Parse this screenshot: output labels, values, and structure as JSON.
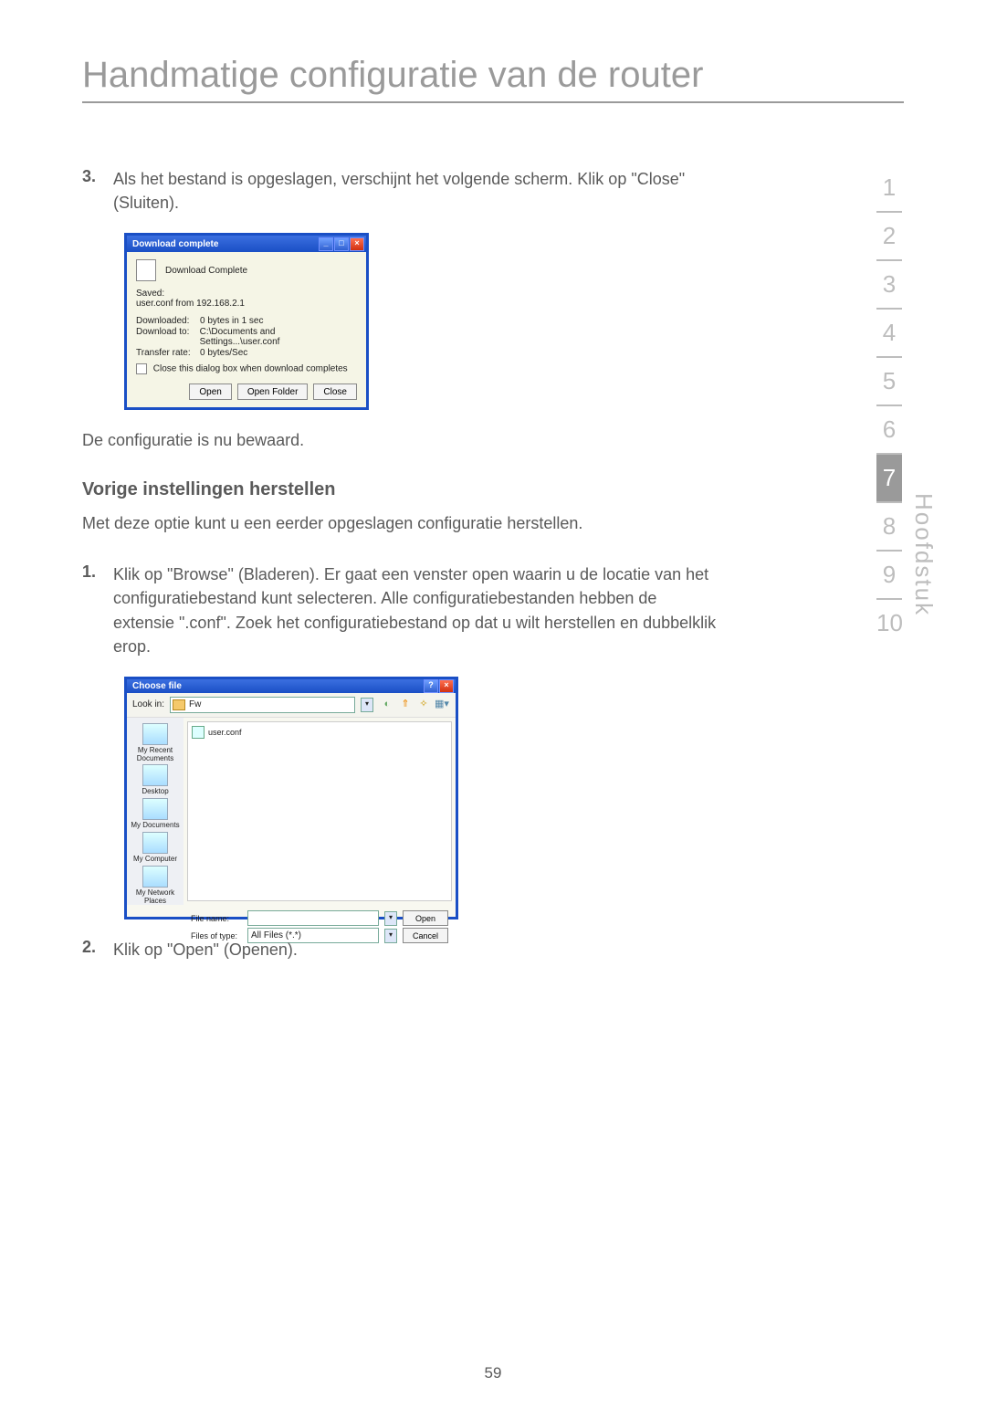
{
  "title": "Handmatige configuratie van de router",
  "pageNumber": "59",
  "sidebar": {
    "label": "Hoofdstuk",
    "chapters": [
      "1",
      "2",
      "3",
      "4",
      "5",
      "6",
      "7",
      "8",
      "9",
      "10"
    ],
    "activeIndex": 6
  },
  "step3": {
    "num": "3.",
    "text": "Als het bestand is opgeslagen, verschijnt het volgende scherm. Klik op \"Close\" (Sluiten)."
  },
  "dialog1": {
    "title": "Download complete",
    "headerText": "Download Complete",
    "savedLabel": "Saved:",
    "savedValue": "user.conf from 192.168.2.1",
    "downloadedLabel": "Downloaded:",
    "downloadedValue": "0 bytes in 1 sec",
    "downloadToLabel": "Download to:",
    "downloadToValue": "C:\\Documents and Settings...\\user.conf",
    "transferRateLabel": "Transfer rate:",
    "transferRateValue": "0 bytes/Sec",
    "checkboxLabel": "Close this dialog box when download completes",
    "openBtn": "Open",
    "openFolderBtn": "Open Folder",
    "closeBtn": "Close"
  },
  "paraSaved": "De configuratie is nu bewaard.",
  "subheading": "Vorige instellingen herstellen",
  "paraRestore": "Met deze optie kunt u een eerder opgeslagen configuratie herstellen.",
  "step1": {
    "num": "1.",
    "text": "Klik op \"Browse\" (Bladeren). Er gaat een venster open waarin u de locatie van het configuratiebestand kunt selecteren. Alle configuratiebestanden hebben de extensie \".conf\". Zoek het configuratiebestand op dat u wilt herstellen en dubbelklik erop."
  },
  "dialog2": {
    "title": "Choose file",
    "lookInLabel": "Look in:",
    "lookInValue": "Fw",
    "fileShown": "user.conf",
    "places": [
      "My Recent Documents",
      "Desktop",
      "My Documents",
      "My Computer",
      "My Network Places"
    ],
    "fileNameLabel": "File name:",
    "fileNameValue": "",
    "filesOfTypeLabel": "Files of type:",
    "filesOfTypeValue": "All Files (*.*)",
    "openBtn": "Open",
    "cancelBtn": "Cancel"
  },
  "step2": {
    "num": "2.",
    "text": "Klik op \"Open\" (Openen)."
  }
}
